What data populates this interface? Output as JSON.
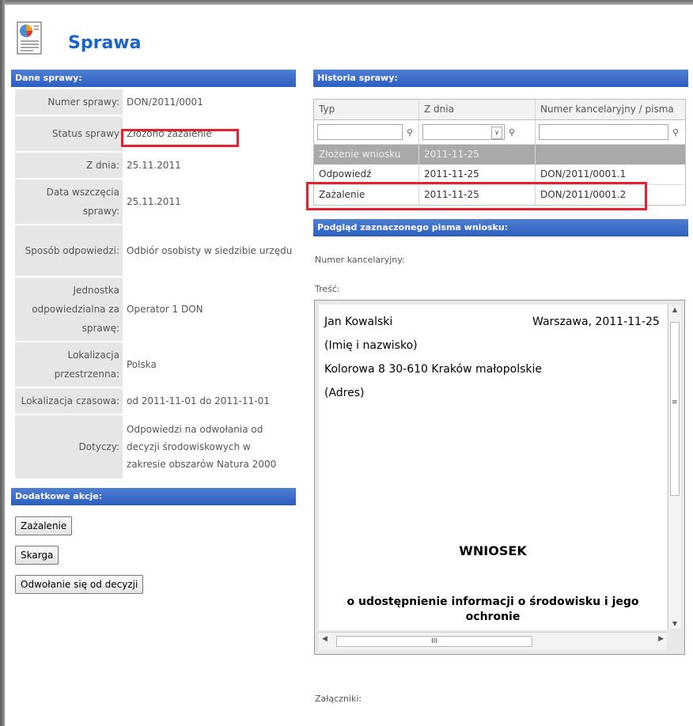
{
  "page": {
    "title": "Sprawa"
  },
  "details": {
    "header": "Dane sprawy:",
    "rows": [
      {
        "label": "Numer sprawy:",
        "value": "DON/2011/0001"
      },
      {
        "label": "Status sprawy",
        "value": "Złożono zażalenie"
      },
      {
        "label": "Z dnia:",
        "value": "25.11.2011"
      },
      {
        "label": "Data wszczęcia sprawy:",
        "value": "25.11.2011"
      },
      {
        "label": "Sposób odpowiedzi:",
        "value": "Odbiór osobisty w siedzibie urzędu"
      },
      {
        "label": "Jednostka odpowiedzialna za sprawę:",
        "value": "Operator 1 DON"
      },
      {
        "label": "Lokalizacja przestrzenna:",
        "value": "Polska"
      },
      {
        "label": "Lokalizacja czasowa:",
        "value": "od 2011-11-01 do 2011-11-01"
      },
      {
        "label": "Dotyczy:",
        "value": "Odpowiedzi na odwołania od decyzji środowiskowych w zakresie obszarów Natura 2000"
      }
    ]
  },
  "actions": {
    "header": "Dodatkowe akcje:",
    "buttons": [
      "Zażalenie",
      "Skarga",
      "Odwołanie się od decyzji"
    ]
  },
  "history": {
    "header": "Historia sprawy:",
    "columns": [
      "Typ",
      "Z dnia",
      "Numer kancelaryjny / pisma"
    ],
    "rows": [
      {
        "typ": "Złożenie wniosku",
        "date": "2011-11-25",
        "number": ""
      },
      {
        "typ": "Odpowiedź",
        "date": "2011-11-25",
        "number": "DON/2011/0001.1"
      },
      {
        "typ": "Zażalenie",
        "date": "2011-11-25",
        "number": "DON/2011/0001.2"
      }
    ]
  },
  "preview": {
    "header": "Podgląd zaznaczonego pisma wniosku:",
    "number_label": "Numer kancelaryjny:",
    "content_label": "Treść:",
    "attachments_label": "Załączniki:",
    "doc": {
      "name": "Jan Kowalski",
      "place_date": "Warszawa, 2011-11-25",
      "name_caption": "(Imię i nazwisko)",
      "address": "Kolorowa 8 30-610 Kraków małopolskie",
      "address_caption": "(Adres)",
      "title": "WNIOSEK",
      "subtitle": "o udostępnienie informacji o środowisku i jego ochronie"
    },
    "hscroll_grip": "III"
  },
  "colors": {
    "accent": "#1c64c4",
    "section_header": "#3a6bc8",
    "highlight": "#e52030"
  }
}
